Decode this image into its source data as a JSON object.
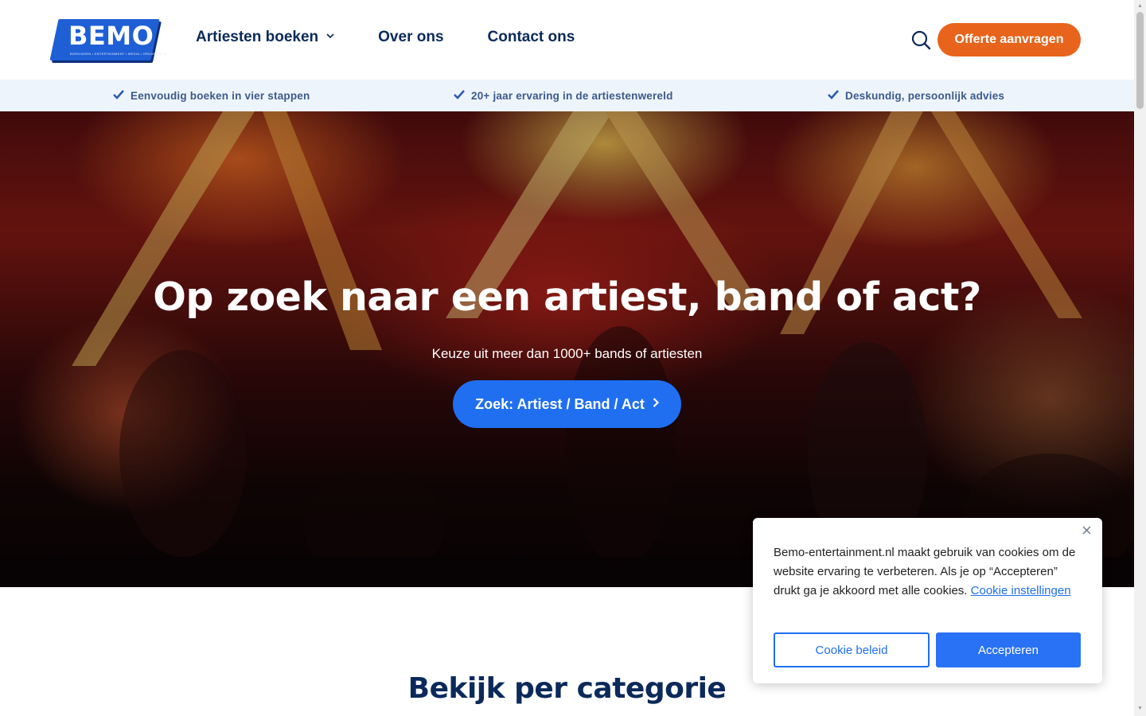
{
  "brand": {
    "logo_text": "BEMO",
    "logo_tagline": "BOEKINGEN • ENTERTAINMENT • MEDIA • ORGANISATIE"
  },
  "nav": {
    "items": [
      {
        "label": "Artiesten boeken",
        "has_dropdown": true
      },
      {
        "label": "Over ons"
      },
      {
        "label": "Contact ons"
      }
    ],
    "search_icon": "search-icon",
    "cta_label": "Offerte aanvragen"
  },
  "usp": {
    "items": [
      "Eenvoudig boeken in vier stappen",
      "20+ jaar ervaring in de artiestenwereld",
      "Deskundig, persoonlijk advies"
    ],
    "icon": "check-icon"
  },
  "hero": {
    "title": "Op zoek naar een artiest, band of act?",
    "subtitle": "Keuze uit meer dan 1000+ bands of artiesten",
    "button_label": "Zoek: Artiest / Band / Act"
  },
  "section": {
    "title": "Bekijk per categorie"
  },
  "cookie": {
    "text": "Bemo-entertainment.nl maakt gebruik van cookies om de website ervaring te verbeteren. Als je op “Accepteren” drukt ga je akkoord met alle cookies.",
    "link_label": "Cookie instellingen",
    "policy_button": "Cookie beleid",
    "accept_button": "Accepteren"
  },
  "colors": {
    "primary_blue": "#1f6ff0",
    "navy_text": "#0b2a5b",
    "cta_orange": "#e8641c",
    "usp_bg": "#eef4fb"
  }
}
